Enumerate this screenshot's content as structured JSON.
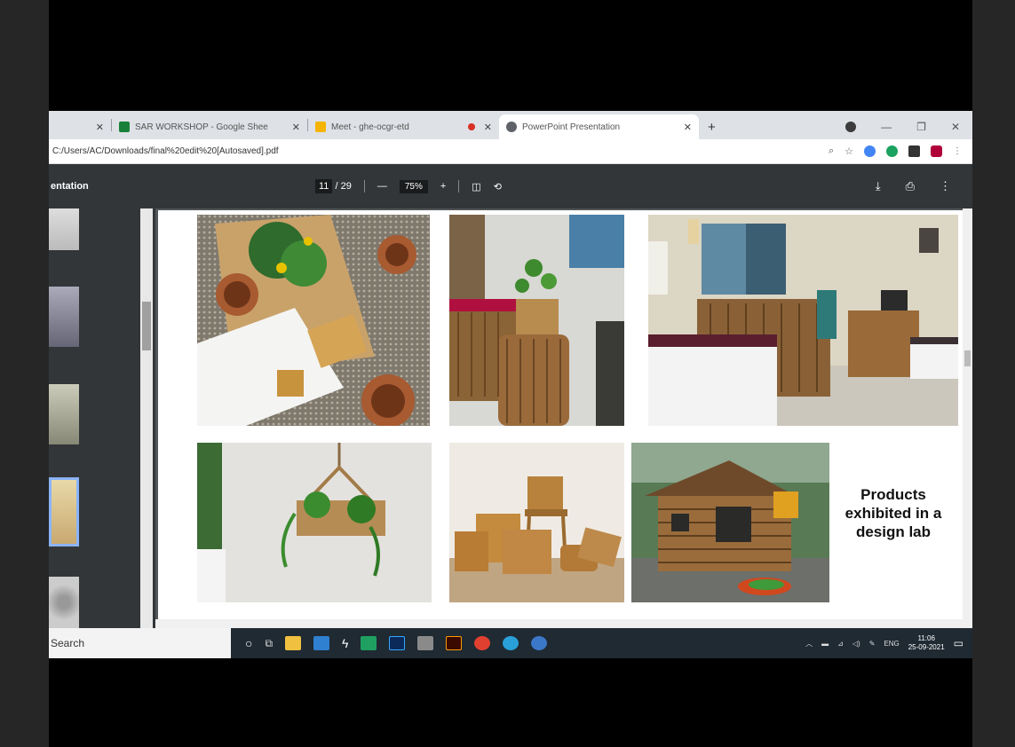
{
  "browser": {
    "tabs": [
      {
        "label": "",
        "favicon_color": "#dee1e6",
        "active": false
      },
      {
        "label": "SAR WORKSHOP - Google Shee",
        "favicon_color": "#188038",
        "active": false
      },
      {
        "label": "Meet - ghe-ocgr-etd",
        "favicon_color": "#f4b400",
        "active": false
      },
      {
        "label": "PowerPoint Presentation",
        "favicon_color": "#5f6368",
        "active": true
      }
    ],
    "address": "C:/Users/AC/Downloads/final%20edit%20[Autosaved].pdf"
  },
  "pdf_toolbar": {
    "title": "entation",
    "page_current": "11",
    "page_total": "/ 29",
    "zoom": "75%",
    "minus": "—",
    "plus": "+"
  },
  "slide": {
    "caption": "Products exhibited in a design lab"
  },
  "taskbar": {
    "search": "Search",
    "lang": "ENG",
    "time": "11:06",
    "date": "25-09-2021"
  },
  "colors": {
    "accent": "#8ab4f8",
    "toolbar": "#323639",
    "taskbar": "#1f2a33"
  }
}
